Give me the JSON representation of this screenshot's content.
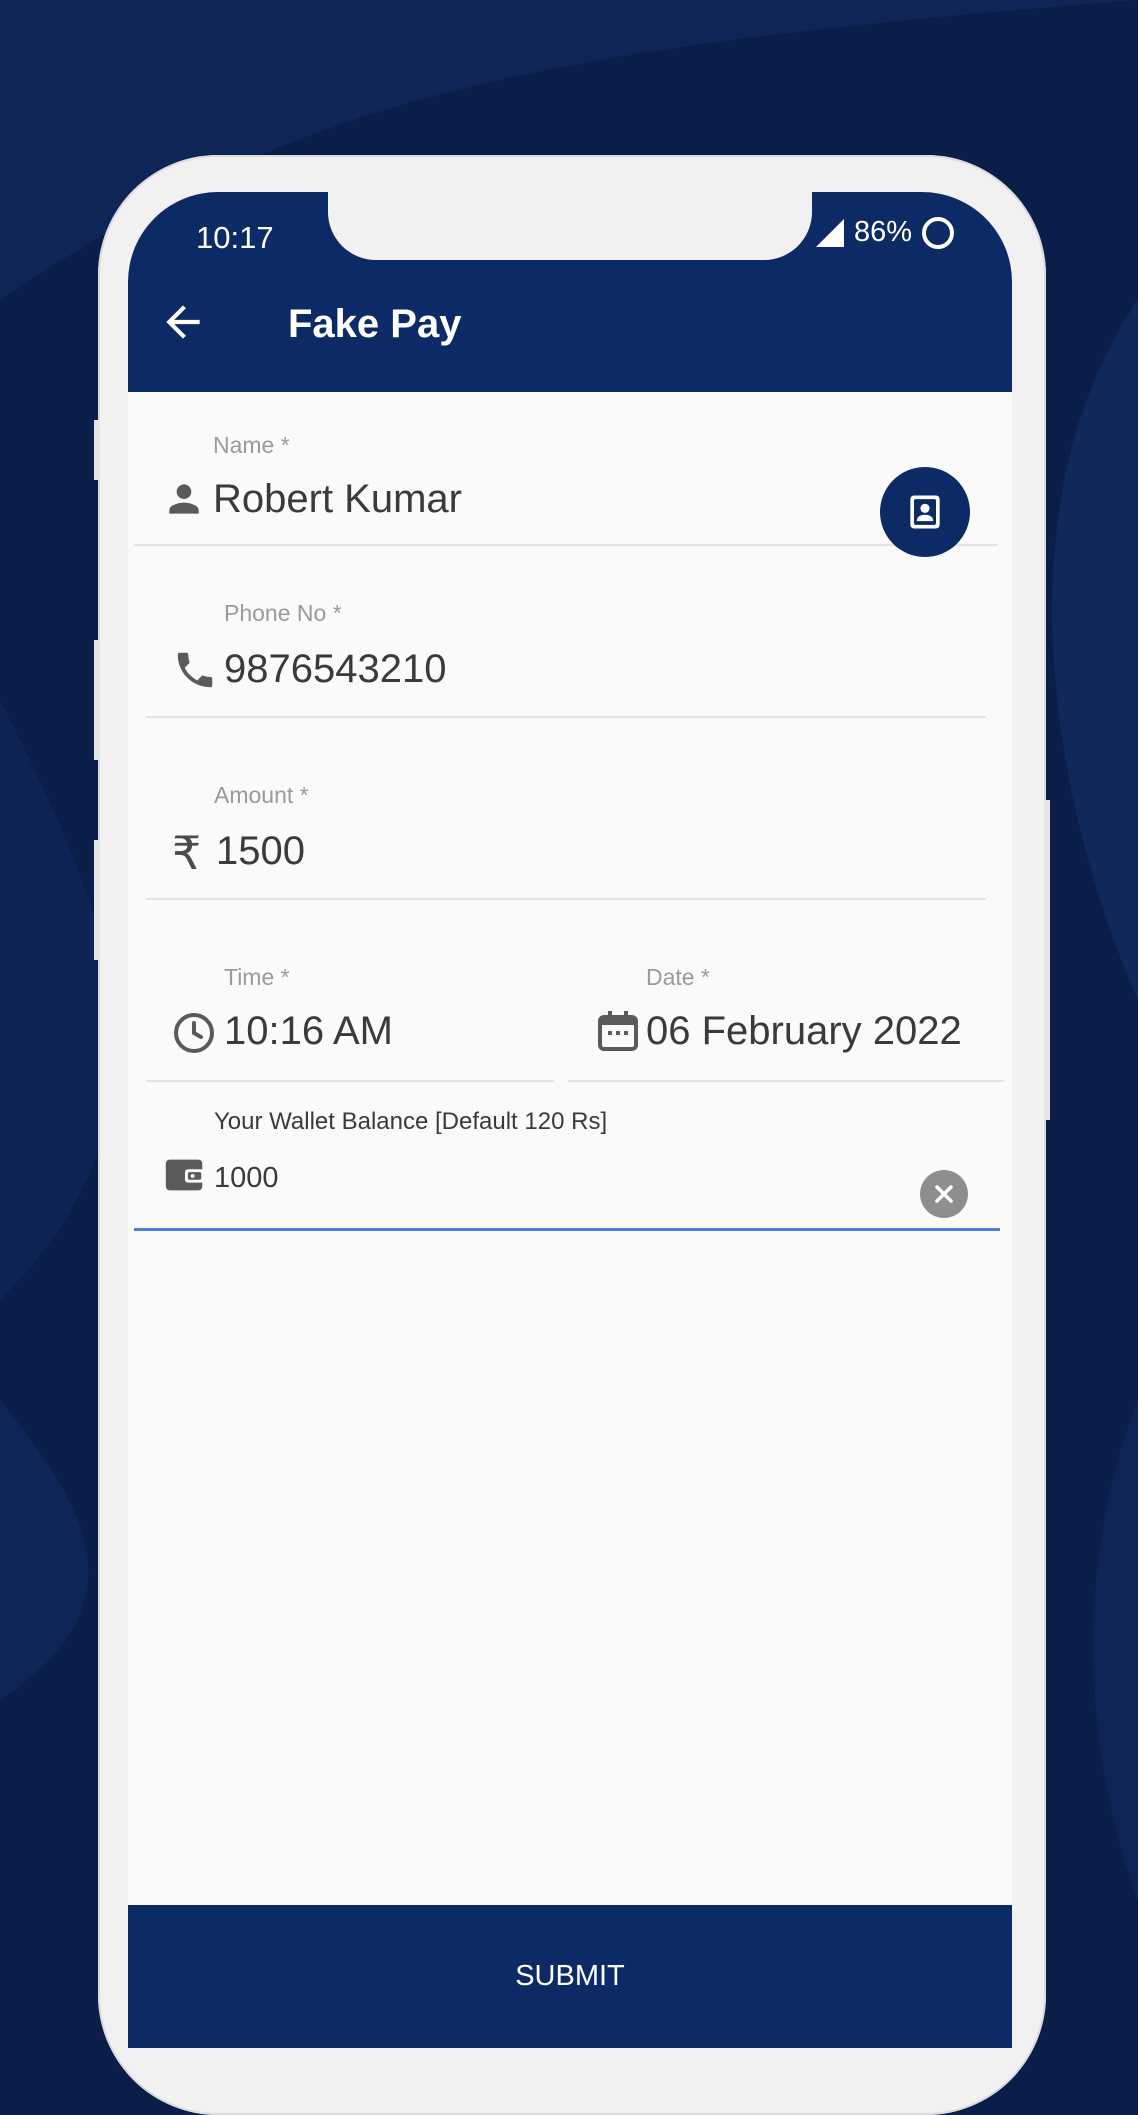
{
  "status_bar": {
    "time": "10:17",
    "battery": "86%"
  },
  "app_bar": {
    "title": "Fake Pay"
  },
  "form": {
    "name": {
      "label": "Name *",
      "value": "Robert Kumar"
    },
    "phone": {
      "label": "Phone No *",
      "value": "9876543210"
    },
    "amount": {
      "label": "Amount *",
      "currency_symbol": "₹",
      "value": "1500"
    },
    "time": {
      "label": "Time *",
      "value": "10:16 AM"
    },
    "date": {
      "label": "Date *",
      "value": "06 February 2022"
    },
    "wallet": {
      "label": "Your Wallet Balance [Default 120 Rs]",
      "value": "1000"
    }
  },
  "submit_label": "SUBMIT",
  "colors": {
    "primary": "#0b2a66",
    "background": "#0b1e4a",
    "focus_line": "#4f7fd8"
  },
  "icons": [
    "back-arrow-icon",
    "person-icon",
    "contact-book-icon",
    "phone-icon",
    "rupee-icon",
    "clock-icon",
    "calendar-icon",
    "wallet-icon",
    "clear-icon",
    "signal-icon",
    "battery-icon"
  ]
}
